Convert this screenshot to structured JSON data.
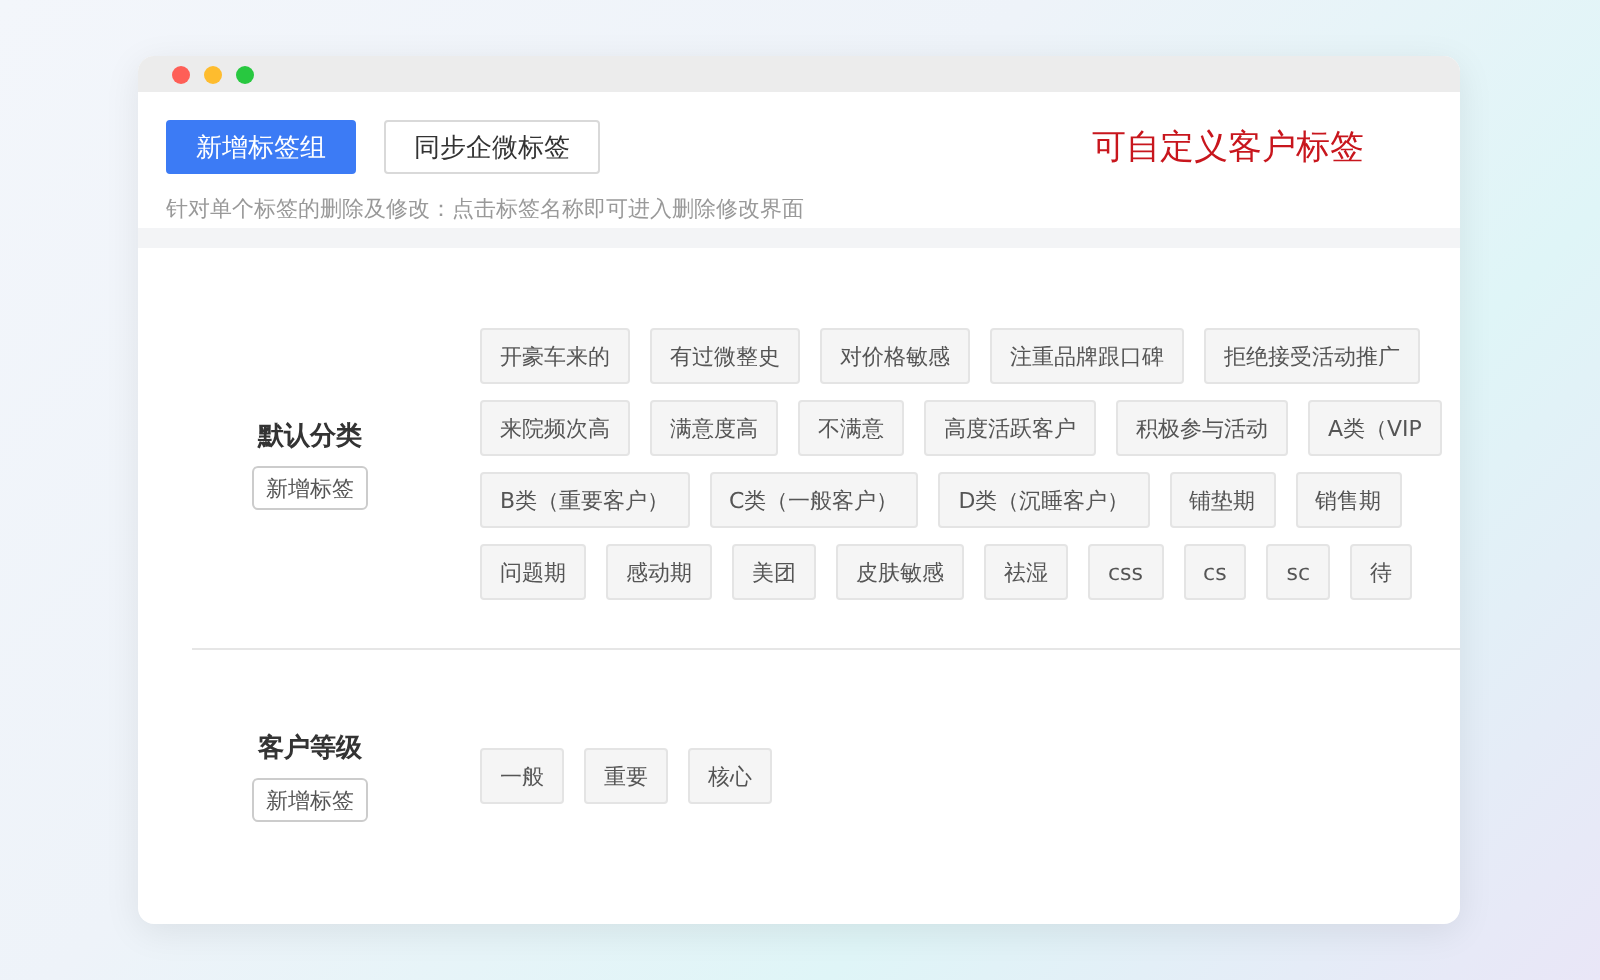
{
  "toolbar": {
    "buttons": [
      {
        "label": "新增标签组",
        "kind": "primary"
      },
      {
        "label": "同步企微标签",
        "kind": "default"
      }
    ],
    "hint": "针对单个标签的删除及修改：点击标签名称即可进入删除修改界面",
    "caption": "可自定义客户标签"
  },
  "groups": [
    {
      "name": "默认分类",
      "add_button": "新增标签",
      "tag_rows": [
        [
          "开豪车来的",
          "有过微整史",
          "对价格敏感",
          "注重品牌跟口碑",
          "拒绝接受活动推广"
        ],
        [
          "来院频次高",
          "满意度高",
          "不满意",
          "高度活跃客户",
          "积极参与活动",
          "A类（VIP"
        ],
        [
          "B类（重要客户）",
          "C类（一般客户）",
          "D类（沉睡客户）",
          "铺垫期",
          "销售期"
        ],
        [
          "问题期",
          "感动期",
          "美团",
          "皮肤敏感",
          "祛湿",
          "css",
          "cs",
          "sc",
          "待"
        ]
      ]
    },
    {
      "name": "客户等级",
      "add_button": "新增标签",
      "tag_rows": [
        [
          "一般",
          "重要",
          "核心"
        ]
      ]
    }
  ]
}
